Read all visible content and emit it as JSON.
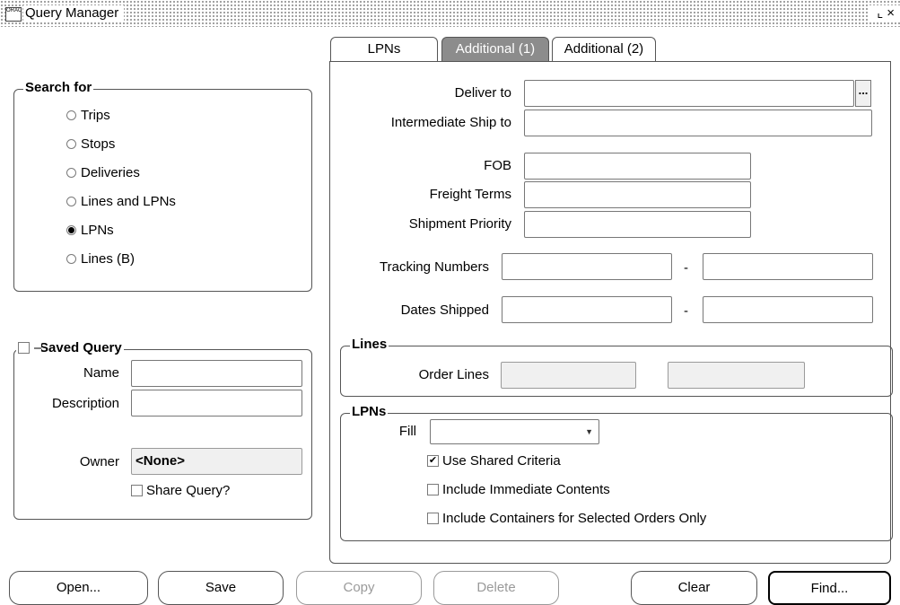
{
  "window": {
    "title": "Query Manager",
    "icon_text": "ORACLE",
    "controls": "⌞ ×"
  },
  "search_for": {
    "title": "Search for",
    "options": [
      {
        "label": "Trips",
        "selected": false
      },
      {
        "label": "Stops",
        "selected": false
      },
      {
        "label": "Deliveries",
        "selected": false
      },
      {
        "label": "Lines and LPNs",
        "selected": false
      },
      {
        "label": "LPNs",
        "selected": true
      },
      {
        "label": "Lines (B)",
        "selected": false
      }
    ]
  },
  "saved_query": {
    "title": "Saved Query",
    "enabled": false,
    "name_label": "Name",
    "name_value": "",
    "description_label": "Description",
    "description_value": "",
    "owner_label": "Owner",
    "owner_value": "<None>",
    "share_label": "Share Query?",
    "share_checked": false
  },
  "tabs": [
    {
      "label": "LPNs",
      "active": false
    },
    {
      "label": "Additional (1)",
      "active": true
    },
    {
      "label": "Additional (2)",
      "active": false
    }
  ],
  "additional1": {
    "deliver_to_label": "Deliver to",
    "deliver_to_value": "",
    "lov_button": "...",
    "intermediate_label": "Intermediate Ship to",
    "intermediate_value": "",
    "fob_label": "FOB",
    "fob_value": "",
    "freight_label": "Freight Terms",
    "freight_value": "",
    "priority_label": "Shipment Priority",
    "priority_value": "",
    "tracking_label": "Tracking Numbers",
    "tracking_from": "",
    "tracking_to": "",
    "dates_label": "Dates Shipped",
    "dates_from": "",
    "dates_to": "",
    "range_separator": "-"
  },
  "lines_group": {
    "title": "Lines",
    "order_lines_label": "Order Lines",
    "order_lines_from": "",
    "order_lines_to": ""
  },
  "lpns_group": {
    "title": "LPNs",
    "fill_label": "Fill",
    "fill_value": "",
    "use_shared_label": "Use Shared Criteria",
    "use_shared_checked": true,
    "immediate_label": "Include Immediate Contents",
    "immediate_checked": false,
    "containers_label": "Include Containers for Selected Orders Only",
    "containers_checked": false
  },
  "buttons": {
    "open": "Open...",
    "save": "Save",
    "copy": "Copy",
    "delete": "Delete",
    "clear": "Clear",
    "find": "Find..."
  }
}
